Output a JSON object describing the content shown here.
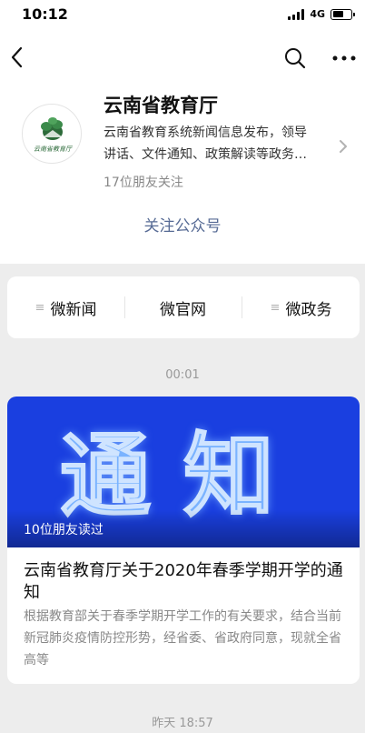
{
  "status_bar": {
    "time": "10:12",
    "network": "4G"
  },
  "profile": {
    "name": "云南省教育厅",
    "logo_text": "云南省教育厅",
    "description_lines": [
      "云南省教育系统新闻信息发布，领导",
      "讲话、文件通知、政策解读等政务…"
    ],
    "friends_following": "17位朋友关注",
    "follow_button": "关注公众号"
  },
  "menu": [
    {
      "label": "微新闻",
      "has_submenu": true
    },
    {
      "label": "微官网",
      "has_submenu": false
    },
    {
      "label": "微政务",
      "has_submenu": true
    }
  ],
  "menu_submenu_glyph": "≡",
  "timestamps": {
    "first": "00:01",
    "second": "昨天 18:57"
  },
  "article": {
    "cover_text": "通知",
    "friends_read": "10位朋友读过",
    "title": "云南省教育厅关于2020年春季学期开学的通知",
    "summary": "根据教育部关于春季学期开学工作的有关要求，结合当前新冠肺炎疫情防控形势，经省委、省政府同意，现就全省高等"
  },
  "colors": {
    "link": "#576b95",
    "cover_blue": "#1a3fe0",
    "logo_green": "#2d6b3a"
  },
  "icons": [
    "back-chevron-icon",
    "search-icon",
    "more-icon",
    "chevron-right-icon",
    "menu-lines-icon",
    "signal-icon",
    "battery-icon"
  ]
}
